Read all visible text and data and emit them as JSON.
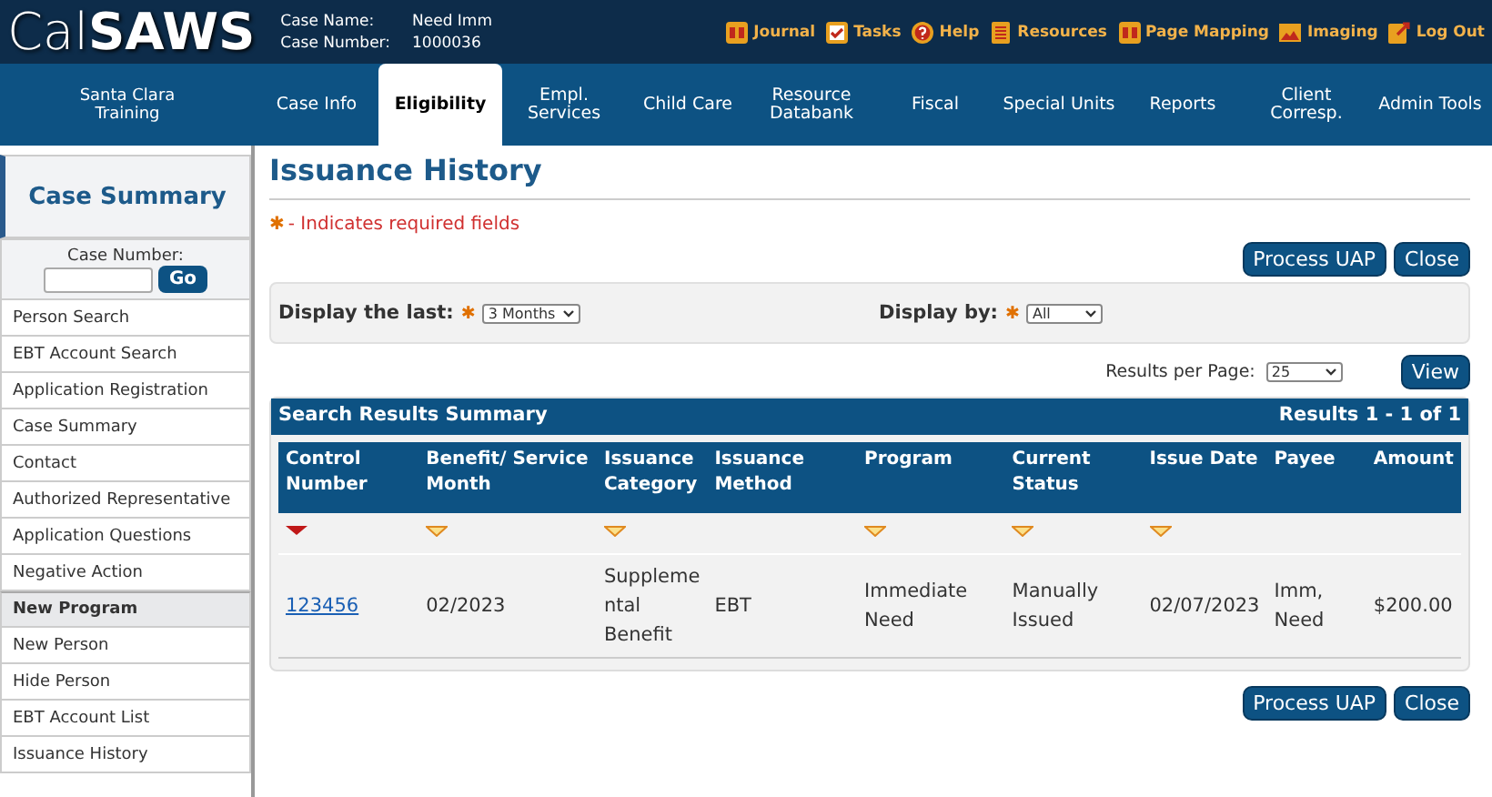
{
  "header": {
    "logo": "Cal**SAWS**",
    "case_fields": [
      {
        "label": "Case Name:",
        "value": "Need Imm"
      },
      {
        "label": "Case Number:",
        "value": "1000036"
      }
    ],
    "links": [
      "Journal",
      "Tasks",
      "Help",
      "Resources",
      "Page Mapping",
      "Imaging",
      "Log Out"
    ]
  },
  "nav": {
    "office": "Santa Clara Training",
    "tabs": [
      {
        "label": "Case Info",
        "selected": false
      },
      {
        "label": "Eligibility",
        "selected": true
      },
      {
        "label": "Empl. Services",
        "selected": false
      },
      {
        "label": "Child Care",
        "selected": false
      },
      {
        "label": "Resource Databank",
        "selected": false
      },
      {
        "label": "Fiscal",
        "selected": false
      },
      {
        "label": "Special Units",
        "selected": false
      },
      {
        "label": "Reports",
        "selected": false
      },
      {
        "label": "Client Corresp.",
        "selected": false
      },
      {
        "label": "Admin Tools",
        "selected": false
      }
    ]
  },
  "sidebar": {
    "title": "Case Summary",
    "case_number_label": "Case Number:",
    "go_button": "Go",
    "items": [
      {
        "kind": "link",
        "label": "Person Search"
      },
      {
        "kind": "link",
        "label": "EBT Account Search"
      },
      {
        "kind": "link",
        "label": "Application Registration"
      },
      {
        "kind": "link",
        "label": "Case Summary"
      },
      {
        "kind": "link",
        "label": "Contact"
      },
      {
        "kind": "link",
        "label": "Authorized Representative"
      },
      {
        "kind": "link",
        "label": "Application Questions"
      },
      {
        "kind": "link",
        "label": "Negative Action"
      },
      {
        "kind": "header",
        "label": "New Program"
      },
      {
        "kind": "link",
        "label": "New Person"
      },
      {
        "kind": "link",
        "label": "Hide Person"
      },
      {
        "kind": "link",
        "label": "EBT Account List"
      },
      {
        "kind": "link",
        "label": "Issuance History"
      }
    ]
  },
  "page": {
    "title": "Issuance History",
    "required_note": "- Indicates required fields",
    "required_mark": "✱",
    "top_buttons": [
      "Process UAP",
      "Close"
    ],
    "filters": [
      {
        "label": "Display the last:",
        "value": "3 Months"
      },
      {
        "label": "Display by:",
        "value": "All"
      }
    ],
    "results_per_page": {
      "label": "Results per Page:",
      "value": "25"
    },
    "view_button": "View",
    "table": {
      "title": "Search Results Summary",
      "range": "Results 1 - 1 of 1",
      "columns": [
        {
          "label": "Control Number",
          "sorted": true
        },
        {
          "label": "Benefit/ Service Month",
          "sorted": false
        },
        {
          "label": "Issuance Category",
          "sorted": false
        },
        {
          "label": "Issuance Method"
        },
        {
          "label": "Program",
          "sorted": false
        },
        {
          "label": "Current Status",
          "sorted": false
        },
        {
          "label": "Issue Date",
          "sorted": false
        },
        {
          "label": "Payee"
        },
        {
          "label": "Amount"
        }
      ],
      "rows": [
        [
          "123456",
          "02/2023",
          "Suppleme ntal Benefit",
          "EBT",
          "Immediate Need",
          "Manually Issued",
          "02/07/2023",
          "Imm, Need",
          "$200.00"
        ]
      ]
    },
    "bottom_buttons": [
      "Process UAP",
      "Close"
    ]
  }
}
